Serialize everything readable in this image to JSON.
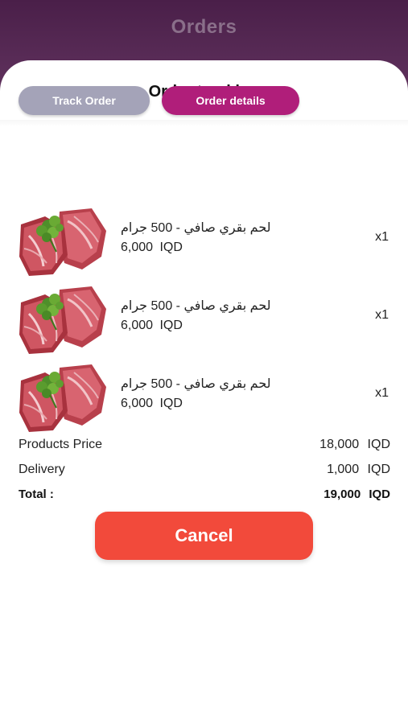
{
  "header": {
    "title": "Orders"
  },
  "sheet": {
    "title": "Order tracking"
  },
  "tabs": [
    {
      "label": "Track Order",
      "active": false
    },
    {
      "label": "Order details",
      "active": true
    }
  ],
  "items": [
    {
      "name": "لحم بقري صافي - 500 جرام",
      "price": "6,000 IQD",
      "qty": "x1"
    },
    {
      "name": "لحم بقري صافي - 500 جرام",
      "price": "6,000 IQD",
      "qty": "x1"
    },
    {
      "name": "لحم بقري صافي - 500 جرام",
      "price": "6,000 IQD",
      "qty": "x1"
    }
  ],
  "summary": {
    "products_label": "Products Price",
    "products_value": "18,000 IQD",
    "delivery_label": "Delivery",
    "delivery_value": "1,000 IQD",
    "total_label": "Total :",
    "total_value": "19,000 IQD"
  },
  "cancel_label": "Cancel",
  "colors": {
    "header_bg": "#4a1f49",
    "tab_inactive": "#a4a3b8",
    "tab_active": "#b01e7a",
    "cancel_bg": "#f24a3b"
  },
  "icons": {
    "product_image": "raw-beef-with-parsley-image"
  }
}
